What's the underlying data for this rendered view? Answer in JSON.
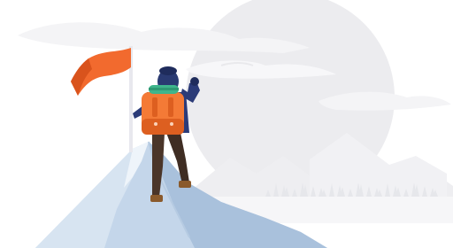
{
  "scene": {
    "subject": "hiker-with-flag-on-summit",
    "colors": {
      "background": "#ffffff",
      "sun": "#ececef",
      "cloud": "#f4f4f6",
      "cloud_outline": "#e9e9ec",
      "far_mountain": "#eeeef1",
      "tree_line": "#e6e7eb",
      "near_mountain_light": "#d7e4f1",
      "near_mountain": "#c4d6ea",
      "near_mountain_shade": "#a9c1dc",
      "snow_highlight": "#eef4fa",
      "flag": "#f26a2e",
      "flag_shade": "#d9531c",
      "flag_pole": "#e8e8ee",
      "backpack": "#f47a36",
      "backpack_shade": "#dd5f20",
      "bedroll": "#3fb58c",
      "jacket": "#2b3b78",
      "jacket_shade": "#1f2c5c",
      "hat": "#2a3a72",
      "pants": "#4a3529",
      "boots": "#8a5a2c",
      "skin": "#f3c7a6"
    },
    "icons": [
      "hiker-icon",
      "flag-icon",
      "mountain-icon",
      "sun-icon",
      "cloud-icon",
      "pine-trees-icon"
    ]
  }
}
